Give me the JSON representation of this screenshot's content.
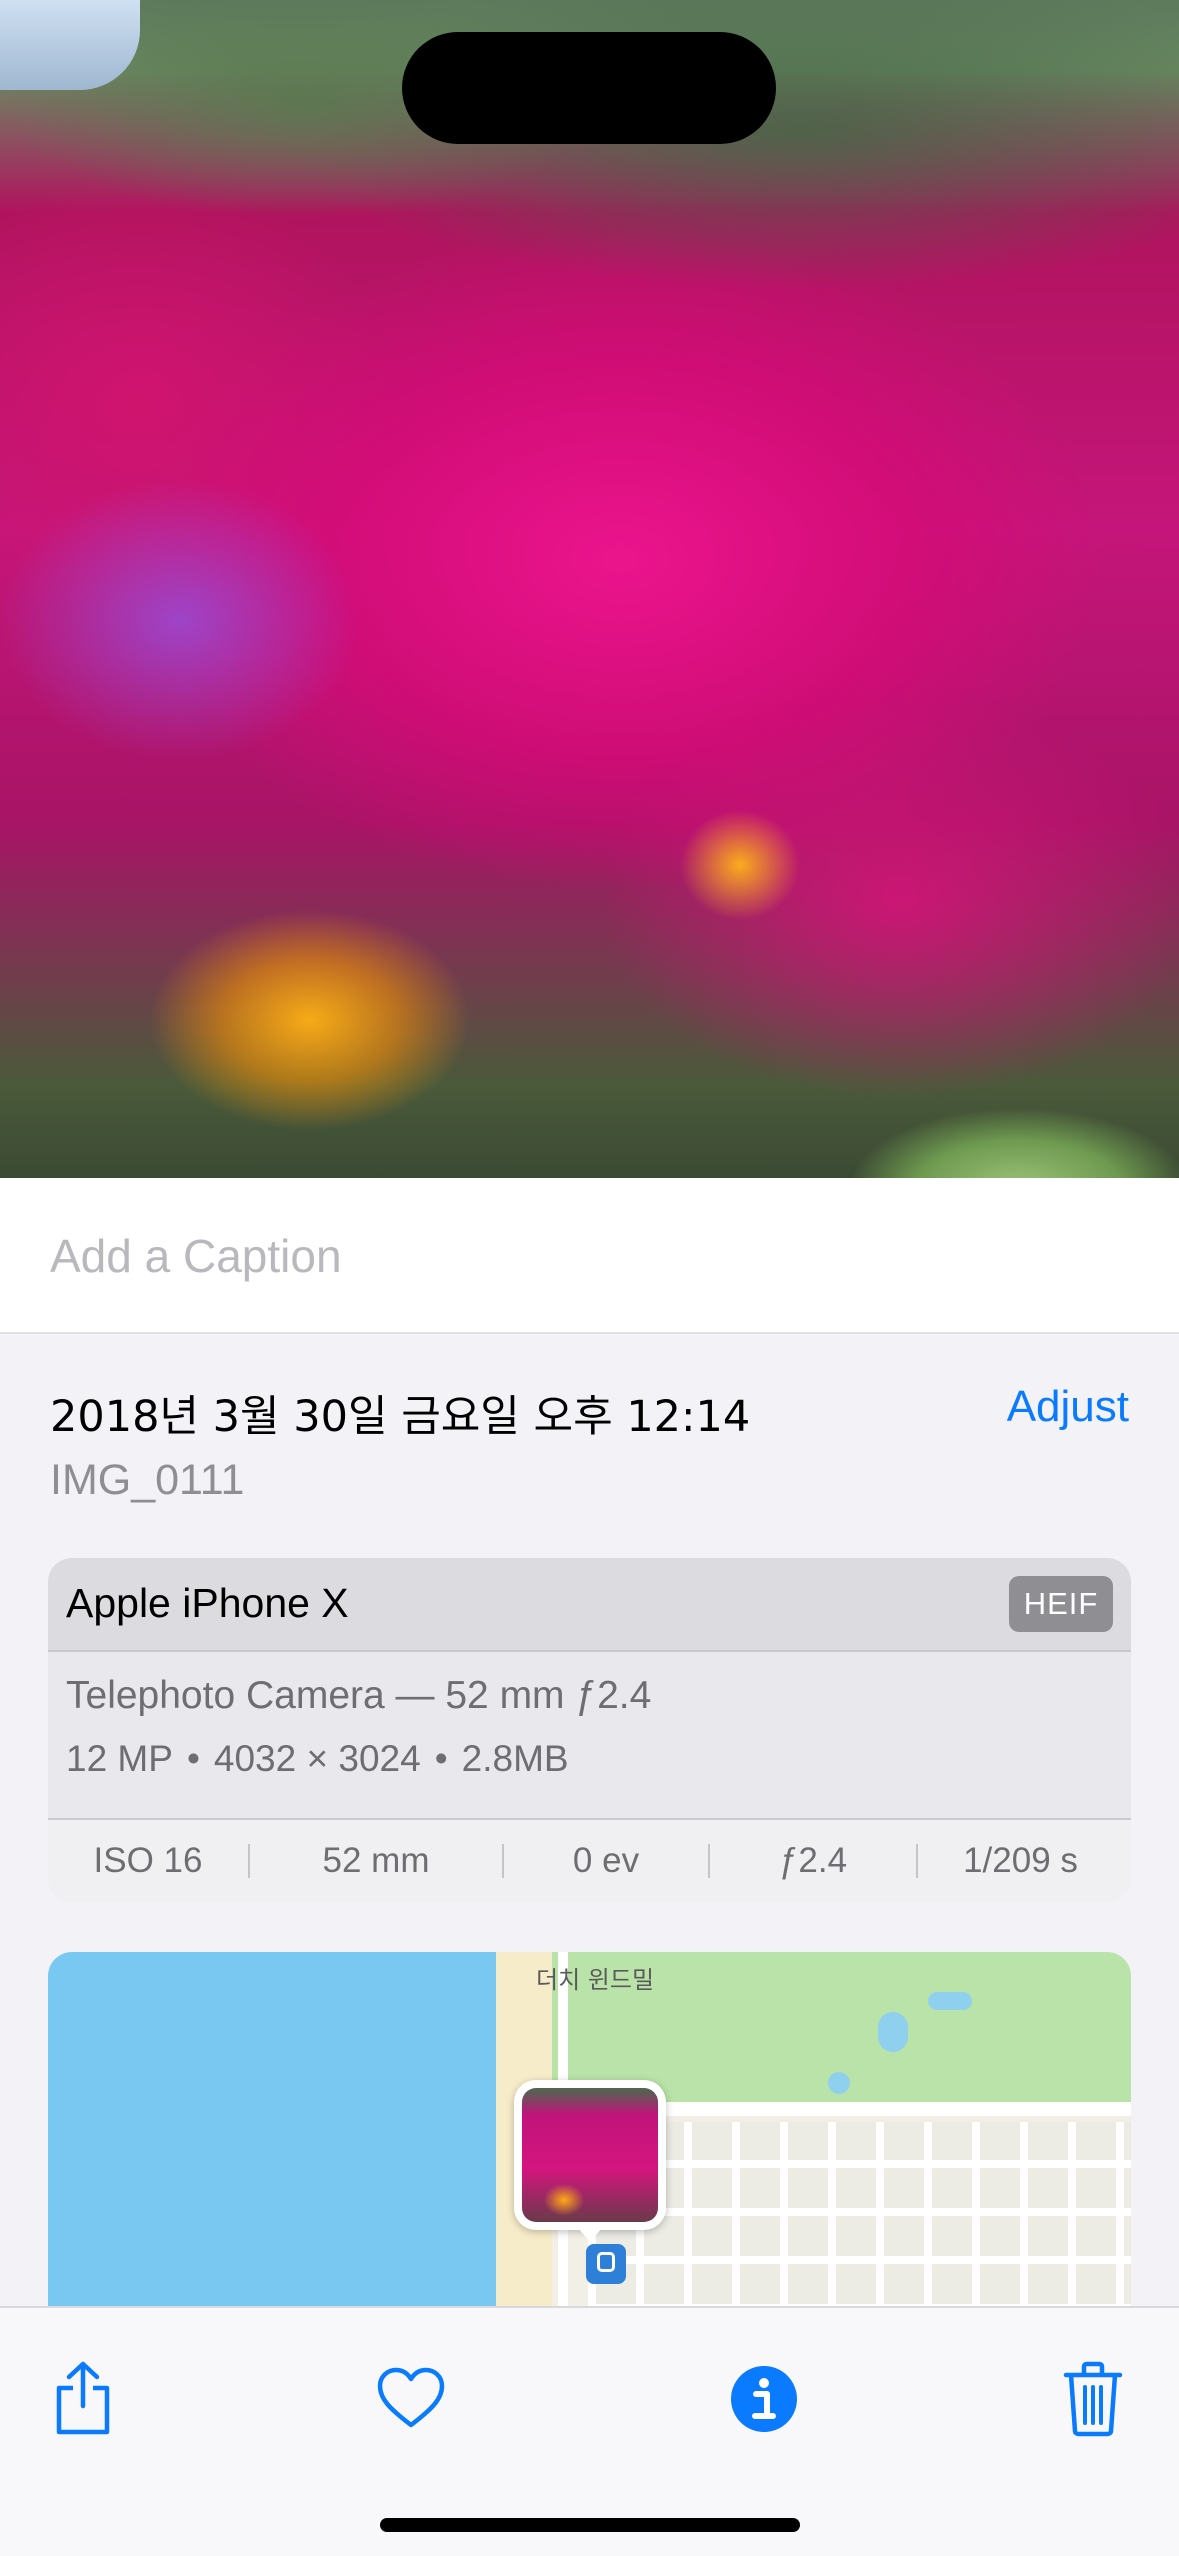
{
  "caption": {
    "placeholder": "Add a Caption"
  },
  "details": {
    "datetime": "2018년 3월 30일 금요일 오후 12:14",
    "adjust_label": "Adjust",
    "filename": "IMG_0111"
  },
  "device": {
    "name": "Apple iPhone X",
    "format_badge": "HEIF",
    "lens": "Telephoto Camera — 52 mm ƒ2.4",
    "megapixels": "12 MP",
    "resolution": "4032 × 3024",
    "file_size": "2.8MB",
    "separator": "•",
    "exif": {
      "iso": "ISO 16",
      "focal_length": "52 mm",
      "exposure_value": "0 ev",
      "aperture": "ƒ2.4",
      "shutter": "1/209 s"
    }
  },
  "map": {
    "place_label": "더치 윈드밀"
  },
  "toolbar": {
    "share_icon": "share-icon",
    "favorite_icon": "heart-icon",
    "info_icon": "info-icon",
    "delete_icon": "trash-icon",
    "accent_color": "#0a7aff"
  }
}
